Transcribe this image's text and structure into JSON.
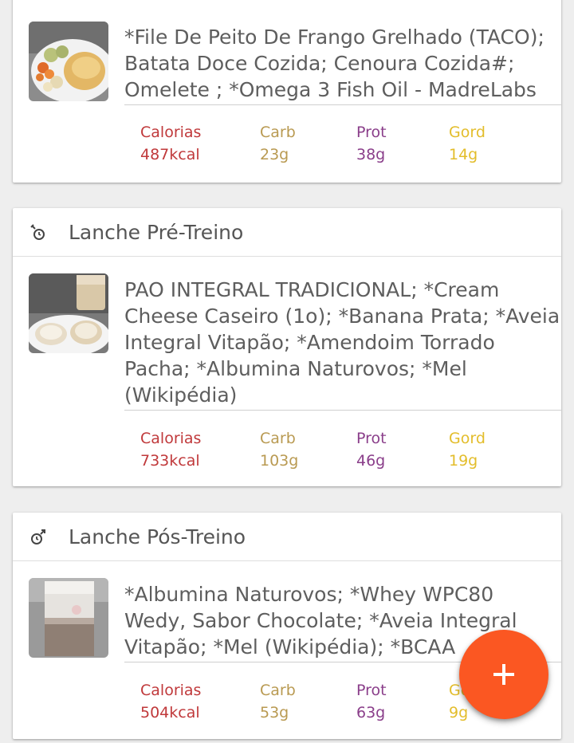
{
  "meals": [
    {
      "header": "",
      "foods": "*File De Peito De Frango Grelhado (TACO); Batata Doce Cozida; Cenoura Cozida#; Omelete ; *Omega 3 Fish Oil - MadreLabs",
      "image_icon": "plate-chicken-omelete-photo",
      "macros": {
        "cal_label": "Calorias",
        "cal_value": "487kcal",
        "carb_label": "Carb",
        "carb_value": "23g",
        "prot_label": "Prot",
        "prot_value": "38g",
        "gord_label": "Gord",
        "gord_value": "14g"
      }
    },
    {
      "header": "Lanche Pré-Treino",
      "header_icon": "pre-workout-clock-icon",
      "foods": "PAO INTEGRAL TRADICIONAL; *Cream Cheese Caseiro (1o); *Banana Prata; *Aveia Integral Vitapão; *Amendoim Torrado Pacha; *Albumina Naturovos; *Mel (Wikipédia)",
      "image_icon": "bread-and-shake-photo",
      "macros": {
        "cal_label": "Calorias",
        "cal_value": "733kcal",
        "carb_label": "Carb",
        "carb_value": "103g",
        "prot_label": "Prot",
        "prot_value": "46g",
        "gord_label": "Gord",
        "gord_value": "19g"
      }
    },
    {
      "header": "Lanche Pós-Treino",
      "header_icon": "post-workout-clock-icon",
      "foods": "*Albumina Naturovos; *Whey WPC80 Wedy, Sabor Chocolate; *Aveia Integral Vitapão; *Mel (Wikipédia); *BCAA",
      "image_icon": "shaker-bottle-photo",
      "macros": {
        "cal_label": "Calorias",
        "cal_value": "504kcal",
        "carb_label": "Carb",
        "carb_value": "53g",
        "prot_label": "Prot",
        "prot_value": "63g",
        "gord_label": "Gord",
        "gord_value": "9g"
      }
    }
  ],
  "fab": {
    "icon": "plus-icon"
  },
  "colors": {
    "calorias": "#c0393b",
    "carb": "#b99a52",
    "prot": "#8a3e8a",
    "gord": "#e3bd2b",
    "fab": "#fb5722"
  }
}
